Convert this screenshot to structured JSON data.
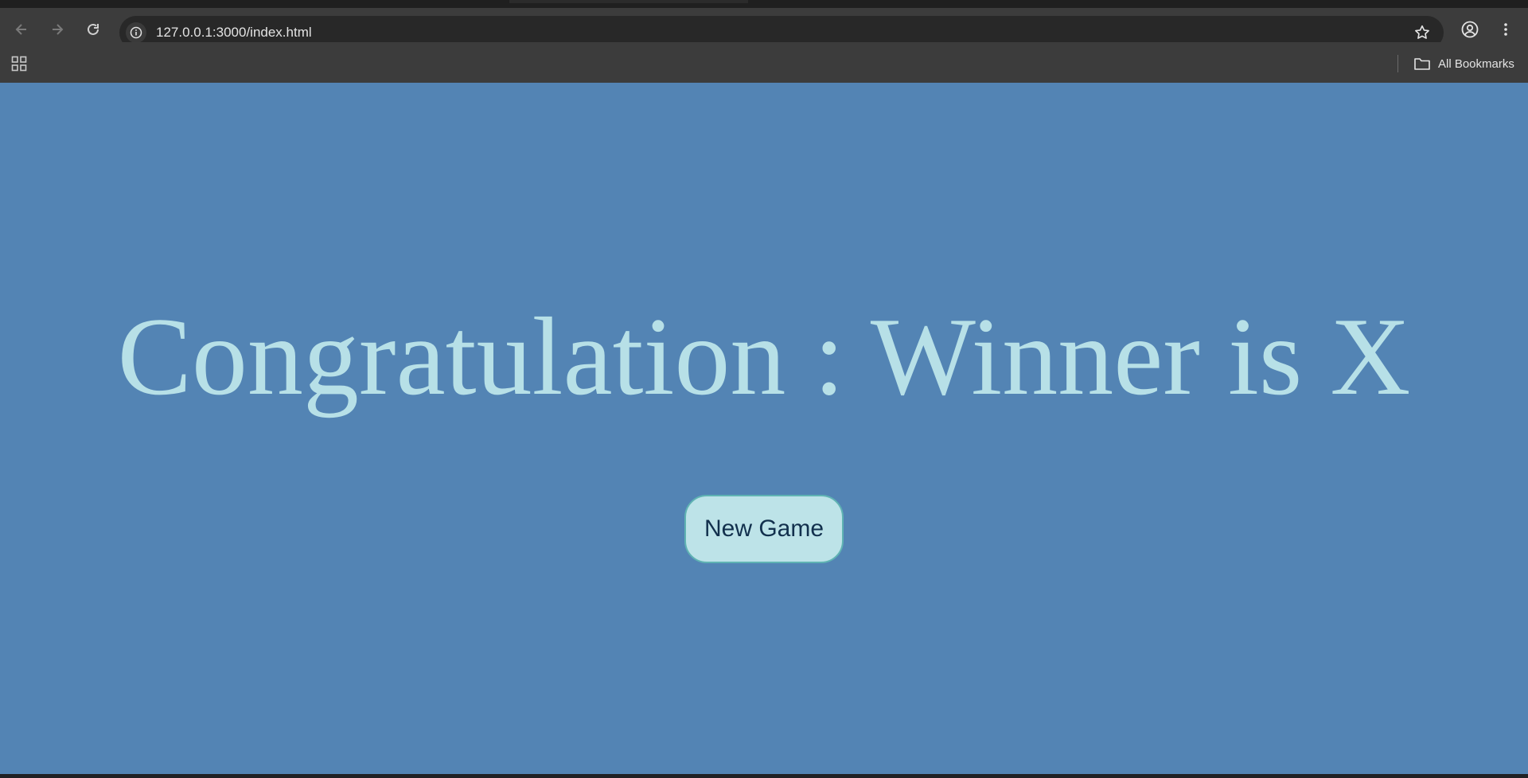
{
  "browser": {
    "url": "127.0.0.1:3000/index.html",
    "bookmarks_label": "All Bookmarks"
  },
  "game": {
    "message": "Congratulation : Winner is X",
    "new_game_label": "New Game"
  },
  "colors": {
    "page_background": "#5384b4",
    "headline": "#b7e0e7",
    "button_background": "#bde3e8",
    "button_text": "#12304d"
  },
  "icons": [
    "back-arrow-icon",
    "forward-arrow-icon",
    "reload-icon",
    "site-info-icon",
    "bookmark-star-icon",
    "profile-icon",
    "more-menu-icon",
    "apps-grid-icon",
    "folder-icon"
  ]
}
